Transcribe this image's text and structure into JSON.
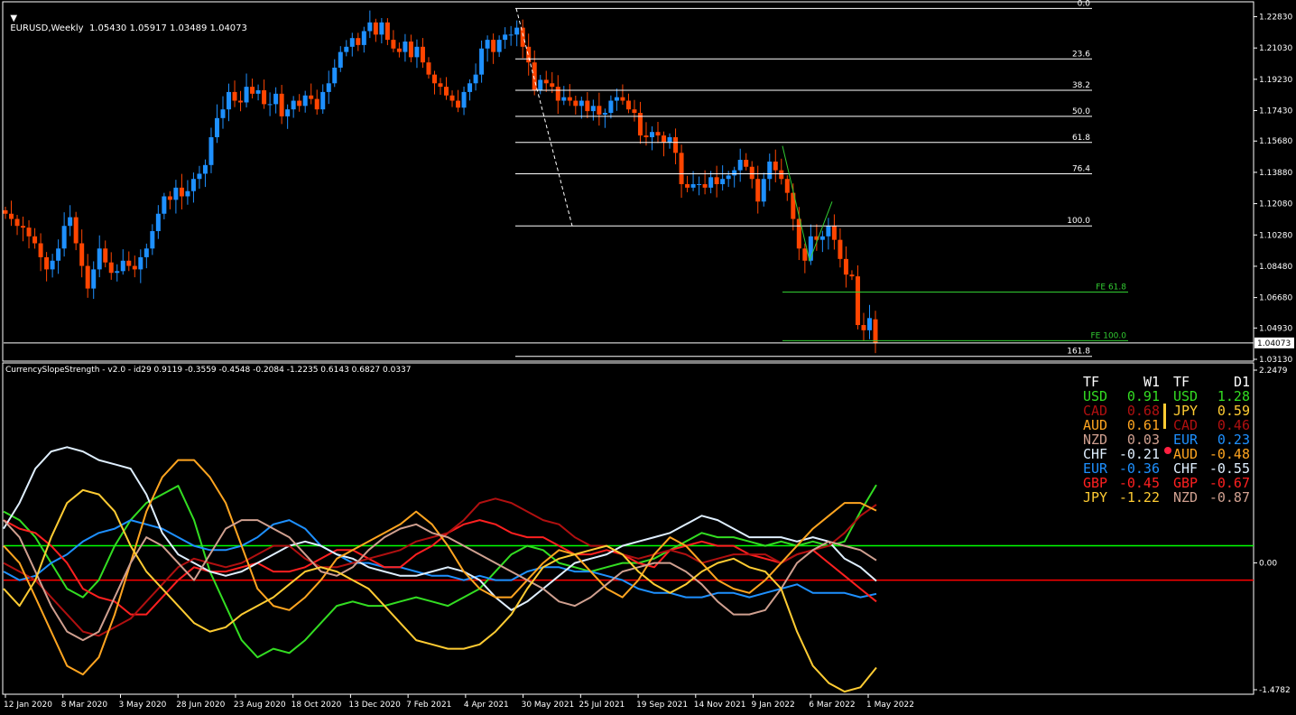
{
  "price_panel": {
    "header": "EURUSD,Weekly  1.05430 1.05917 1.03489 1.04073",
    "current_price": "1.04073",
    "price_range": [
      1.0313,
      1.2353
    ],
    "price_ticks": [
      "1.22830",
      "1.21030",
      "1.19230",
      "1.17430",
      "1.15680",
      "1.13880",
      "1.12080",
      "1.10280",
      "1.08480",
      "1.06680",
      "1.04930",
      "1.03130"
    ],
    "colors": {
      "bull": "#1E90FF",
      "bear": "#FF4500",
      "fib": "#ffffff",
      "fe": "#32CD32"
    }
  },
  "chart_data": [
    {
      "type": "candlestick",
      "title": "EURUSD,Weekly",
      "ohlc_last": {
        "open": 1.0543,
        "high": 1.05917,
        "low": 1.03489,
        "close": 1.04073
      },
      "close_series": [
        1.115,
        1.112,
        1.108,
        1.107,
        1.102,
        1.098,
        1.09,
        1.083,
        1.088,
        1.095,
        1.108,
        1.113,
        1.098,
        1.085,
        1.072,
        1.083,
        1.095,
        1.087,
        1.081,
        1.082,
        1.088,
        1.085,
        1.083,
        1.09,
        1.095,
        1.105,
        1.115,
        1.125,
        1.123,
        1.13,
        1.125,
        1.128,
        1.135,
        1.138,
        1.143,
        1.159,
        1.17,
        1.175,
        1.185,
        1.18,
        1.179,
        1.188,
        1.184,
        1.186,
        1.178,
        1.178,
        1.184,
        1.171,
        1.175,
        1.18,
        1.177,
        1.183,
        1.181,
        1.175,
        1.185,
        1.19,
        1.199,
        1.208,
        1.211,
        1.216,
        1.212,
        1.22,
        1.225,
        1.218,
        1.225,
        1.215,
        1.21,
        1.208,
        1.214,
        1.205,
        1.211,
        1.202,
        1.195,
        1.19,
        1.188,
        1.183,
        1.18,
        1.176,
        1.185,
        1.19,
        1.195,
        1.21,
        1.215,
        1.208,
        1.215,
        1.218,
        1.218,
        1.222,
        1.211,
        1.202,
        1.186,
        1.192,
        1.19,
        1.188,
        1.18,
        1.182,
        1.18,
        1.177,
        1.18,
        1.174,
        1.177,
        1.172,
        1.173,
        1.18,
        1.182,
        1.18,
        1.175,
        1.173,
        1.16,
        1.159,
        1.162,
        1.16,
        1.156,
        1.159,
        1.15,
        1.132,
        1.13,
        1.132,
        1.132,
        1.13,
        1.136,
        1.132,
        1.135,
        1.137,
        1.14,
        1.146,
        1.142,
        1.135,
        1.122,
        1.135,
        1.145,
        1.14,
        1.135,
        1.127,
        1.112,
        1.095,
        1.088,
        1.102,
        1.1,
        1.102,
        1.108,
        1.1,
        1.089,
        1.08,
        1.079,
        1.051,
        1.048,
        1.055,
        1.0407
      ],
      "y_range": [
        1.0313,
        1.2353
      ],
      "x_tick_labels": [
        "12 Jan 2020",
        "8 Mar 2020",
        "3 May 2020",
        "28 Jun 2020",
        "23 Aug 2020",
        "18 Oct 2020",
        "13 Dec 2020",
        "7 Feb 2021",
        "4 Apr 2021",
        "30 May 2021",
        "25 Jul 2021",
        "19 Sep 2021",
        "14 Nov 2021",
        "9 Jan 2022",
        "6 Mar 2022",
        "1 May 2022"
      ],
      "fib_levels": [
        {
          "label": "0.0",
          "price": 1.233
        },
        {
          "label": "23.6",
          "price": 1.204
        },
        {
          "label": "38.2",
          "price": 1.186
        },
        {
          "label": "50.0",
          "price": 1.171
        },
        {
          "label": "61.8",
          "price": 1.156
        },
        {
          "label": "76.4",
          "price": 1.138
        },
        {
          "label": "100.0",
          "price": 1.108
        }
      ],
      "fib_extension_levels": [
        {
          "label": "FE 61.8",
          "price": 1.07
        },
        {
          "label": "FE 100.0",
          "price": 1.042
        },
        {
          "label": "161.8",
          "price": 1.033
        }
      ]
    },
    {
      "type": "line",
      "title": "CurrencySlopeStrength - v2.0 - id29 0.9119 -0.3559 -0.4548 -0.2084 -1.2235 0.6143 0.6827 0.0337",
      "y_ticks": [
        "2.2479",
        "0.00",
        "-1.4782"
      ],
      "levels": [
        {
          "value": 0.2,
          "color": "#00FF00"
        },
        {
          "value": -0.2,
          "color": "#FF0000"
        }
      ],
      "y_range": [
        -1.4782,
        2.2479
      ],
      "series": [
        {
          "name": "USD",
          "color": "#33dd22",
          "values": [
            0.6,
            0.5,
            0.3,
            0.0,
            -0.3,
            -0.4,
            -0.2,
            0.2,
            0.5,
            0.7,
            0.8,
            0.9,
            0.5,
            -0.1,
            -0.5,
            -0.9,
            -1.1,
            -1.0,
            -1.05,
            -0.9,
            -0.7,
            -0.5,
            -0.45,
            -0.5,
            -0.5,
            -0.45,
            -0.4,
            -0.45,
            -0.5,
            -0.4,
            -0.3,
            -0.1,
            0.1,
            0.2,
            0.15,
            0.0,
            -0.05,
            -0.1,
            -0.05,
            0.0,
            0.0,
            0.05,
            0.15,
            0.25,
            0.35,
            0.3,
            0.3,
            0.25,
            0.2,
            0.25,
            0.2,
            0.25,
            0.2,
            0.25,
            0.6,
            0.91
          ]
        },
        {
          "name": "EUR",
          "color": "#1e90ff",
          "values": [
            -0.1,
            -0.2,
            -0.15,
            0.0,
            0.1,
            0.25,
            0.35,
            0.4,
            0.5,
            0.45,
            0.4,
            0.3,
            0.2,
            0.15,
            0.15,
            0.2,
            0.3,
            0.45,
            0.5,
            0.4,
            0.2,
            0.1,
            0.0,
            0.0,
            -0.05,
            -0.05,
            -0.1,
            -0.15,
            -0.15,
            -0.2,
            -0.15,
            -0.2,
            -0.2,
            -0.1,
            -0.05,
            -0.05,
            -0.1,
            -0.1,
            -0.15,
            -0.2,
            -0.3,
            -0.35,
            -0.35,
            -0.4,
            -0.4,
            -0.35,
            -0.35,
            -0.4,
            -0.35,
            -0.3,
            -0.25,
            -0.35,
            -0.35,
            -0.35,
            -0.4,
            -0.36
          ]
        },
        {
          "name": "GBP",
          "color": "#ff2020",
          "values": [
            0.5,
            0.4,
            0.35,
            0.2,
            0.0,
            -0.3,
            -0.4,
            -0.45,
            -0.6,
            -0.6,
            -0.4,
            -0.2,
            -0.05,
            -0.1,
            -0.1,
            -0.05,
            0.0,
            -0.1,
            -0.1,
            -0.05,
            0.05,
            0.15,
            0.15,
            0.05,
            -0.05,
            -0.05,
            0.1,
            0.2,
            0.35,
            0.45,
            0.5,
            0.45,
            0.35,
            0.3,
            0.3,
            0.2,
            0.1,
            0.1,
            0.15,
            0.1,
            0.0,
            -0.05,
            0.15,
            0.2,
            0.25,
            0.2,
            0.2,
            0.1,
            0.05,
            0.0,
            0.1,
            0.15,
            0.0,
            -0.15,
            -0.3,
            -0.45
          ]
        },
        {
          "name": "CHF",
          "color": "#dfefff",
          "values": [
            0.4,
            0.7,
            1.1,
            1.3,
            1.35,
            1.3,
            1.2,
            1.15,
            1.1,
            0.8,
            0.35,
            0.1,
            0.0,
            -0.1,
            -0.15,
            -0.1,
            0.0,
            0.1,
            0.2,
            0.25,
            0.2,
            0.1,
            0.05,
            -0.05,
            -0.1,
            -0.15,
            -0.15,
            -0.1,
            -0.05,
            -0.1,
            -0.2,
            -0.4,
            -0.55,
            -0.45,
            -0.3,
            -0.15,
            0.0,
            0.05,
            0.1,
            0.2,
            0.25,
            0.3,
            0.35,
            0.45,
            0.55,
            0.5,
            0.4,
            0.3,
            0.3,
            0.3,
            0.25,
            0.3,
            0.25,
            0.05,
            -0.05,
            -0.21
          ]
        },
        {
          "name": "CAD",
          "color": "#b01010",
          "values": [
            0.0,
            -0.1,
            -0.2,
            -0.4,
            -0.6,
            -0.8,
            -0.85,
            -0.75,
            -0.65,
            -0.45,
            -0.25,
            -0.05,
            0.05,
            0.0,
            -0.05,
            0.0,
            0.1,
            0.2,
            0.2,
            0.05,
            -0.05,
            -0.05,
            0.0,
            0.05,
            0.1,
            0.15,
            0.25,
            0.3,
            0.35,
            0.5,
            0.7,
            0.75,
            0.7,
            0.6,
            0.5,
            0.45,
            0.3,
            0.2,
            0.2,
            0.1,
            0.05,
            0.1,
            0.15,
            0.1,
            0.0,
            0.05,
            0.1,
            0.1,
            0.1,
            0.0,
            0.1,
            0.15,
            0.2,
            0.35,
            0.55,
            0.68
          ]
        },
        {
          "name": "AUD",
          "color": "#ffa520",
          "values": [
            0.2,
            0.0,
            -0.4,
            -0.8,
            -1.2,
            -1.3,
            -1.1,
            -0.6,
            0.0,
            0.6,
            1.0,
            1.2,
            1.2,
            1.0,
            0.7,
            0.2,
            -0.3,
            -0.5,
            -0.55,
            -0.4,
            -0.2,
            0.05,
            0.15,
            0.25,
            0.35,
            0.45,
            0.6,
            0.45,
            0.2,
            -0.1,
            -0.3,
            -0.4,
            -0.4,
            -0.2,
            0.0,
            0.15,
            0.1,
            -0.1,
            -0.3,
            -0.4,
            -0.2,
            0.1,
            0.3,
            0.2,
            0.0,
            -0.2,
            -0.3,
            -0.35,
            -0.2,
            0.0,
            0.2,
            0.4,
            0.55,
            0.7,
            0.7,
            0.61
          ]
        },
        {
          "name": "NZD",
          "color": "#d0a090",
          "values": [
            0.5,
            0.3,
            -0.1,
            -0.5,
            -0.8,
            -0.9,
            -0.8,
            -0.4,
            0.0,
            0.3,
            0.2,
            0.0,
            -0.2,
            0.1,
            0.4,
            0.5,
            0.5,
            0.4,
            0.3,
            0.1,
            -0.1,
            -0.15,
            -0.05,
            0.15,
            0.3,
            0.4,
            0.45,
            0.35,
            0.3,
            0.2,
            0.1,
            0.0,
            -0.1,
            -0.2,
            -0.3,
            -0.45,
            -0.5,
            -0.4,
            -0.25,
            -0.1,
            -0.05,
            0.0,
            0.0,
            -0.1,
            -0.25,
            -0.45,
            -0.6,
            -0.6,
            -0.55,
            -0.3,
            0.0,
            0.15,
            0.25,
            0.2,
            0.15,
            0.03
          ]
        },
        {
          "name": "JPY",
          "color": "#ffcc33",
          "values": [
            -0.3,
            -0.5,
            -0.2,
            0.3,
            0.7,
            0.85,
            0.8,
            0.6,
            0.2,
            -0.1,
            -0.3,
            -0.5,
            -0.7,
            -0.8,
            -0.75,
            -0.6,
            -0.5,
            -0.4,
            -0.25,
            -0.1,
            -0.05,
            -0.1,
            -0.2,
            -0.3,
            -0.5,
            -0.7,
            -0.9,
            -0.95,
            -1.0,
            -1.0,
            -0.95,
            -0.8,
            -0.6,
            -0.3,
            -0.05,
            0.05,
            0.1,
            0.15,
            0.2,
            0.1,
            -0.1,
            -0.25,
            -0.35,
            -0.25,
            -0.1,
            0.0,
            0.05,
            -0.05,
            -0.1,
            -0.3,
            -0.8,
            -1.2,
            -1.4,
            -1.5,
            -1.45,
            -1.22
          ]
        }
      ]
    }
  ],
  "indicator_panel": {
    "header": "CurrencySlopeStrength - v2.0 - id29 0.9119 -0.3559 -0.4548 -0.2084 -1.2235 0.6143 0.6827 0.0337",
    "strength_table": {
      "w1": {
        "tf_label": "TF",
        "period_label": "W1",
        "rows": [
          {
            "ccy": "USD",
            "val": "0.91",
            "color": "#33dd22"
          },
          {
            "ccy": "CAD",
            "val": "0.68",
            "color": "#b01010"
          },
          {
            "ccy": "AUD",
            "val": "0.61",
            "color": "#ffa520"
          },
          {
            "ccy": "NZD",
            "val": "0.03",
            "color": "#d0a090"
          },
          {
            "ccy": "CHF",
            "val": "-0.21",
            "color": "#dfefff"
          },
          {
            "ccy": "EUR",
            "val": "-0.36",
            "color": "#1e90ff"
          },
          {
            "ccy": "GBP",
            "val": "-0.45",
            "color": "#ff2020"
          },
          {
            "ccy": "JPY",
            "val": "-1.22",
            "color": "#ffcc33"
          }
        ]
      },
      "d1": {
        "tf_label": "TF",
        "period_label": "D1",
        "rows": [
          {
            "ccy": "USD",
            "val": "1.28",
            "color": "#33dd22"
          },
          {
            "ccy": "JPY",
            "val": "0.59",
            "color": "#ffcc33"
          },
          {
            "ccy": "CAD",
            "val": "0.46",
            "color": "#b01010"
          },
          {
            "ccy": "EUR",
            "val": "0.23",
            "color": "#1e90ff"
          },
          {
            "ccy": "AUD",
            "val": "-0.48",
            "color": "#ffa520"
          },
          {
            "ccy": "CHF",
            "val": "-0.55",
            "color": "#dfefff"
          },
          {
            "ccy": "GBP",
            "val": "-0.67",
            "color": "#ff2020"
          },
          {
            "ccy": "NZD",
            "val": "-0.87",
            "color": "#d0a090"
          }
        ]
      }
    }
  }
}
